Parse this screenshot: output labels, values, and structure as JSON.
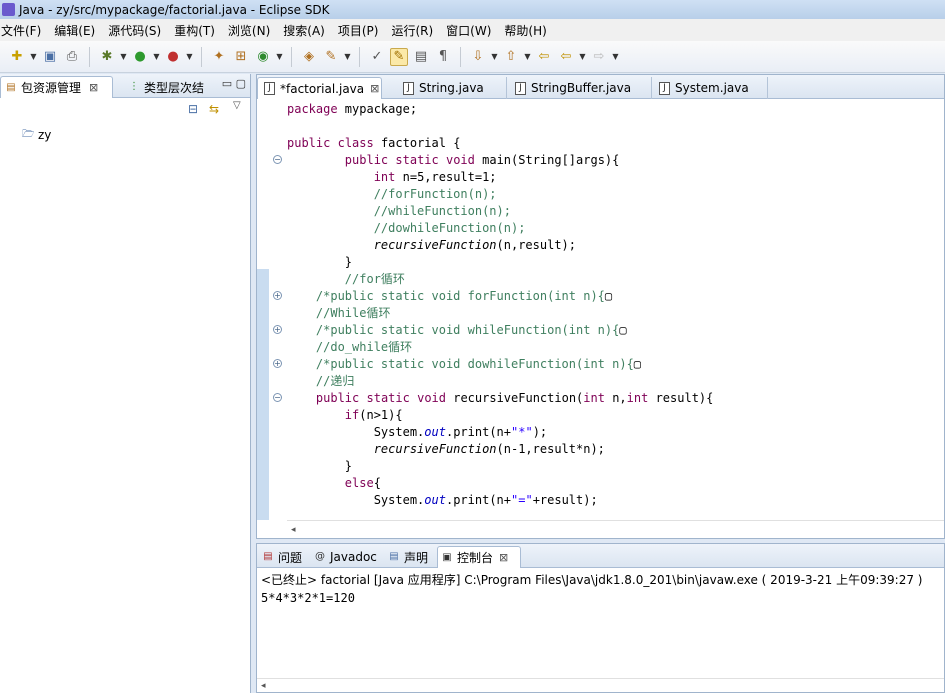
{
  "window": {
    "title": "Java  -  zy/src/mypackage/factorial.java  -  Eclipse SDK"
  },
  "menu": [
    "文件(F)",
    "编辑(E)",
    "源代码(S)",
    "重构(T)",
    "浏览(N)",
    "搜索(A)",
    "项目(P)",
    "运行(R)",
    "窗口(W)",
    "帮助(H)"
  ],
  "left_view": {
    "tabs": [
      {
        "label": "包资源管理",
        "close": "⊠"
      },
      {
        "label": "类型层次结"
      }
    ],
    "tree": [
      {
        "label": "zy"
      }
    ]
  },
  "editor": {
    "tabs": [
      {
        "label": "*factorial.java",
        "close": "⊠"
      },
      {
        "label": "String.java"
      },
      {
        "label": "StringBuffer.java"
      },
      {
        "label": "System.java"
      }
    ]
  },
  "console": {
    "tabs": [
      {
        "label": "问题"
      },
      {
        "label": "Javadoc"
      },
      {
        "label": "声明"
      },
      {
        "label": "控制台",
        "close": "⊠"
      }
    ],
    "terminated_line": "<已终止> factorial [Java 应用程序] C:\\Program Files\\Java\\jdk1.8.0_201\\bin\\javaw.exe ( 2019-3-21 上午09:39:27 )",
    "output": "5*4*3*2*1=120"
  },
  "icons": {
    "window": "java-perspective-icon",
    "java_file": "java-file-icon",
    "project": "project-folder-icon"
  }
}
